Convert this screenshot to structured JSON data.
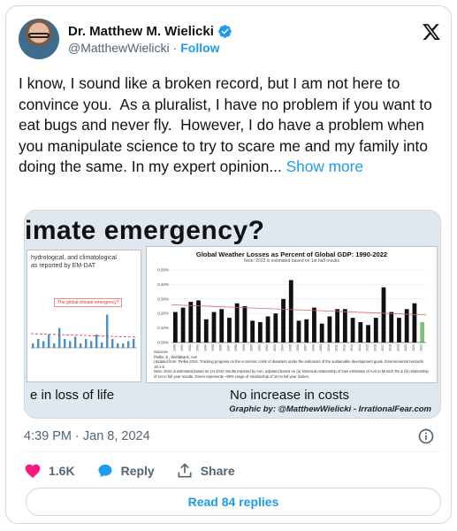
{
  "author": {
    "name": "Dr. Matthew M. Wielicki",
    "handle": "@MatthewWielicki",
    "separator": "·",
    "follow_label": "Follow",
    "verified_color": "#1d9bf0"
  },
  "tweet": {
    "text": "I know, I sound like a broken record, but I am not here to convince you.  As a pluralist, I have no problem if you want to eat bugs and never fly.  However, I do have a problem when you manipulate science to try to scare me and my family into doing the same. In my expert opinion... ",
    "show_more": "Show more"
  },
  "media": {
    "headline": "imate emergency?",
    "left_panel_title": "hydrological, and climatological\n as reported by EM-DAT",
    "left_panel_callout": "The global climate emergency?",
    "caption_left": "e in loss of life",
    "caption_mid": "No increase in costs",
    "credit": "Graphic by: @MatthewWielicki - IrrationalFear.com",
    "notes": "Sources:\nPielke Jr., WorldBank, Aon\nUpdated from: Pielke 2019. Tracking progress on the economic costs of disasters under the indicators of the sustainable development goals. Environmental Hazards 18:1-6.\nNote: 2022 is estimated based on 1H 2022 results reported by Aon, adjusted based on (a) historical relationship of loss estimates of Aon to Munich Re & (b) relationship of 1H to full year results. Green represents ~90% range of relationship of 1H to full year losses."
  },
  "chart_data": {
    "type": "bar",
    "title": "Global Weather Losses as Percent of Global GDP: 1990-2022",
    "subtitle": "Note: 2022 is estimated based on 1st half results",
    "categories": [
      "1990",
      "1991",
      "1992",
      "1993",
      "1994",
      "1995",
      "1996",
      "1997",
      "1998",
      "1999",
      "2000",
      "2001",
      "2002",
      "2003",
      "2004",
      "2005",
      "2006",
      "2007",
      "2008",
      "2009",
      "2010",
      "2011",
      "2012",
      "2013",
      "2014",
      "2015",
      "2016",
      "2017",
      "2018",
      "2019",
      "2020",
      "2021",
      "2022"
    ],
    "values": [
      0.21,
      0.24,
      0.28,
      0.29,
      0.16,
      0.21,
      0.23,
      0.17,
      0.27,
      0.25,
      0.15,
      0.14,
      0.18,
      0.2,
      0.3,
      0.43,
      0.15,
      0.16,
      0.24,
      0.13,
      0.18,
      0.23,
      0.23,
      0.17,
      0.14,
      0.12,
      0.17,
      0.38,
      0.21,
      0.17,
      0.23,
      0.27,
      0.14
    ],
    "ylim": [
      0,
      0.5
    ],
    "yticks": [
      "0.50%",
      "0.40%",
      "0.30%",
      "0.20%",
      "0.10%",
      "0.00%"
    ],
    "trend_start": 0.26,
    "trend_end": 0.19,
    "bar_color": "#111111",
    "trend_color": "#e06666"
  },
  "left_chart": {
    "values": [
      0.1,
      0.2,
      0.15,
      0.3,
      0.1,
      0.45,
      0.2,
      0.15,
      0.25,
      0.1,
      0.2,
      0.15,
      0.3,
      0.12,
      0.75,
      0.2,
      0.1,
      0.1,
      0.15,
      0.2
    ],
    "bar_color": "#4a90c8"
  },
  "footer": {
    "timestamp": "4:39 PM · Jan 8, 2024",
    "likes_label": "1.6K",
    "reply_label": "Reply",
    "share_label": "Share",
    "read_replies_label": "Read 84 replies",
    "like_color": "#f91880",
    "reply_color": "#1d9bf0"
  }
}
